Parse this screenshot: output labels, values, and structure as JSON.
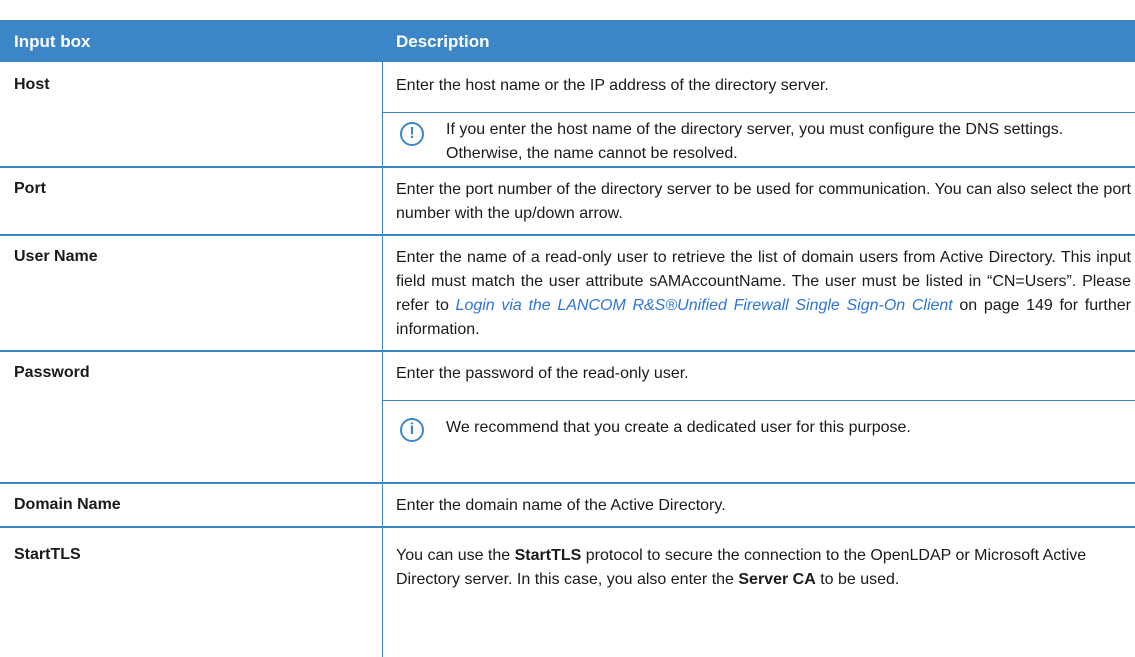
{
  "table": {
    "header": {
      "col1": "Input box",
      "col2": "Description"
    },
    "rows": {
      "host": {
        "label": "Host",
        "desc": "Enter the host name or the IP address of the directory server.",
        "note_icon": "!",
        "note": "If you enter the host name of the directory server, you must configure the DNS settings. Otherwise, the name cannot be resolved."
      },
      "port": {
        "label": "Port",
        "desc": "Enter the port number of the directory server to be used for communication. You can also select the port number with the up/down arrow."
      },
      "username": {
        "label": "User Name",
        "desc_pre": "Enter the name of a read-only user to retrieve the list of domain users from Active Directory. This input field must match the user attribute sAMAccountName. The user must be listed in “CN=Users”. Please refer to ",
        "link": "Login via the LANCOM R&S®Unified Firewall Single Sign-On Client",
        "desc_post": " on page 149 for further information."
      },
      "password": {
        "label": "Password",
        "desc": "Enter the password of the read-only user.",
        "note_icon": "i",
        "note": "We recommend that you create a dedicated user for this purpose."
      },
      "domain": {
        "label": "Domain Name",
        "desc": "Enter the domain name of the Active Directory."
      },
      "starttls": {
        "label": "StartTLS",
        "desc_1": "You can use the ",
        "bold_1": "StartTLS",
        "desc_2": " protocol to secure the connection to the OpenLDAP or Microsoft Active Directory server. In this case, you also enter the ",
        "bold_2": "Server CA",
        "desc_3": " to be used."
      }
    }
  }
}
